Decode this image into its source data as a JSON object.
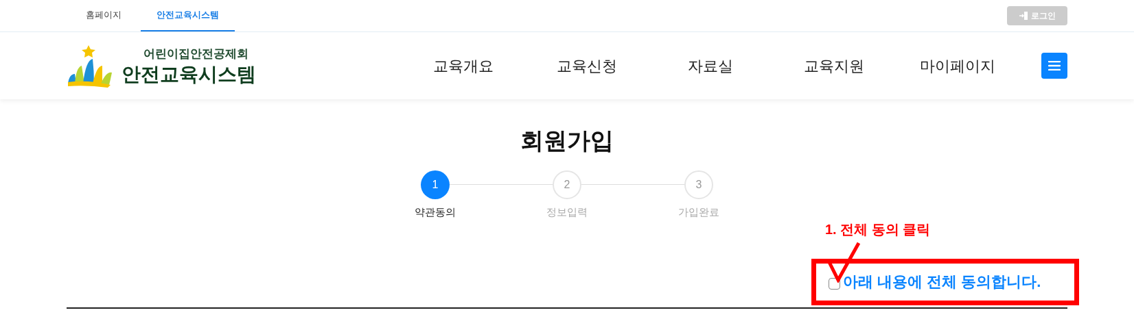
{
  "top_tabs": [
    {
      "label": "홈페이지",
      "selected": false
    },
    {
      "label": "안전교육시스템",
      "selected": true
    }
  ],
  "login_button": "로그인",
  "logo": {
    "org": "어린이집안전공제회",
    "system": "안전교육시스템"
  },
  "nav": [
    "교육개요",
    "교육신청",
    "자료실",
    "교육지원",
    "마이페이지"
  ],
  "title": "회원가입",
  "steps": [
    {
      "number": "1",
      "label": "약관동의",
      "selected": true
    },
    {
      "number": "2",
      "label": "정보입력",
      "selected": false
    },
    {
      "number": "3",
      "label": "가입완료",
      "selected": false
    }
  ],
  "annotation": "1. 전체 동의 클릭",
  "agree_all": {
    "label": "아래 내용에 전체 동의합니다.",
    "checked": false
  }
}
